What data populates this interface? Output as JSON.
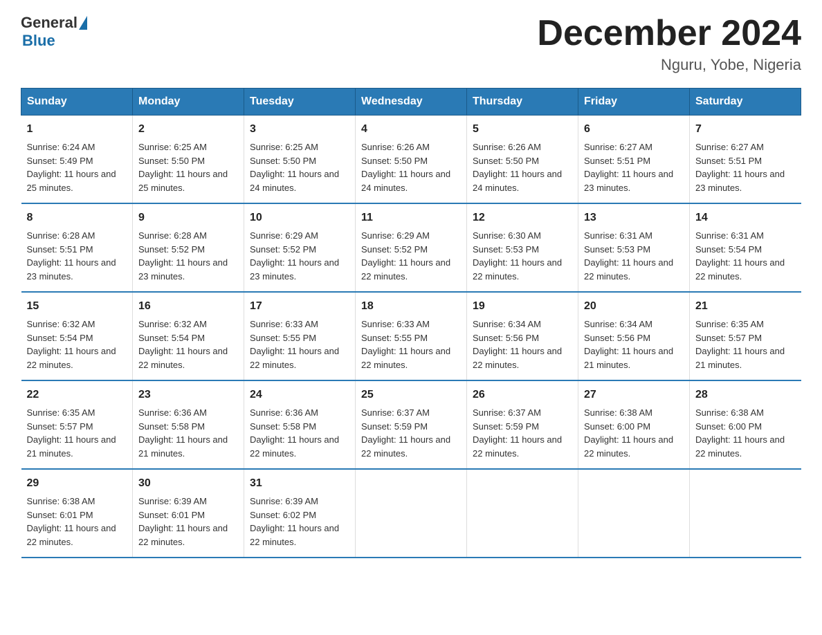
{
  "header": {
    "logo_general": "General",
    "logo_blue": "Blue",
    "month_title": "December 2024",
    "location": "Nguru, Yobe, Nigeria"
  },
  "days_of_week": [
    "Sunday",
    "Monday",
    "Tuesday",
    "Wednesday",
    "Thursday",
    "Friday",
    "Saturday"
  ],
  "weeks": [
    [
      {
        "day": "1",
        "sunrise": "6:24 AM",
        "sunset": "5:49 PM",
        "daylight": "11 hours and 25 minutes."
      },
      {
        "day": "2",
        "sunrise": "6:25 AM",
        "sunset": "5:50 PM",
        "daylight": "11 hours and 25 minutes."
      },
      {
        "day": "3",
        "sunrise": "6:25 AM",
        "sunset": "5:50 PM",
        "daylight": "11 hours and 24 minutes."
      },
      {
        "day": "4",
        "sunrise": "6:26 AM",
        "sunset": "5:50 PM",
        "daylight": "11 hours and 24 minutes."
      },
      {
        "day": "5",
        "sunrise": "6:26 AM",
        "sunset": "5:50 PM",
        "daylight": "11 hours and 24 minutes."
      },
      {
        "day": "6",
        "sunrise": "6:27 AM",
        "sunset": "5:51 PM",
        "daylight": "11 hours and 23 minutes."
      },
      {
        "day": "7",
        "sunrise": "6:27 AM",
        "sunset": "5:51 PM",
        "daylight": "11 hours and 23 minutes."
      }
    ],
    [
      {
        "day": "8",
        "sunrise": "6:28 AM",
        "sunset": "5:51 PM",
        "daylight": "11 hours and 23 minutes."
      },
      {
        "day": "9",
        "sunrise": "6:28 AM",
        "sunset": "5:52 PM",
        "daylight": "11 hours and 23 minutes."
      },
      {
        "day": "10",
        "sunrise": "6:29 AM",
        "sunset": "5:52 PM",
        "daylight": "11 hours and 23 minutes."
      },
      {
        "day": "11",
        "sunrise": "6:29 AM",
        "sunset": "5:52 PM",
        "daylight": "11 hours and 22 minutes."
      },
      {
        "day": "12",
        "sunrise": "6:30 AM",
        "sunset": "5:53 PM",
        "daylight": "11 hours and 22 minutes."
      },
      {
        "day": "13",
        "sunrise": "6:31 AM",
        "sunset": "5:53 PM",
        "daylight": "11 hours and 22 minutes."
      },
      {
        "day": "14",
        "sunrise": "6:31 AM",
        "sunset": "5:54 PM",
        "daylight": "11 hours and 22 minutes."
      }
    ],
    [
      {
        "day": "15",
        "sunrise": "6:32 AM",
        "sunset": "5:54 PM",
        "daylight": "11 hours and 22 minutes."
      },
      {
        "day": "16",
        "sunrise": "6:32 AM",
        "sunset": "5:54 PM",
        "daylight": "11 hours and 22 minutes."
      },
      {
        "day": "17",
        "sunrise": "6:33 AM",
        "sunset": "5:55 PM",
        "daylight": "11 hours and 22 minutes."
      },
      {
        "day": "18",
        "sunrise": "6:33 AM",
        "sunset": "5:55 PM",
        "daylight": "11 hours and 22 minutes."
      },
      {
        "day": "19",
        "sunrise": "6:34 AM",
        "sunset": "5:56 PM",
        "daylight": "11 hours and 22 minutes."
      },
      {
        "day": "20",
        "sunrise": "6:34 AM",
        "sunset": "5:56 PM",
        "daylight": "11 hours and 21 minutes."
      },
      {
        "day": "21",
        "sunrise": "6:35 AM",
        "sunset": "5:57 PM",
        "daylight": "11 hours and 21 minutes."
      }
    ],
    [
      {
        "day": "22",
        "sunrise": "6:35 AM",
        "sunset": "5:57 PM",
        "daylight": "11 hours and 21 minutes."
      },
      {
        "day": "23",
        "sunrise": "6:36 AM",
        "sunset": "5:58 PM",
        "daylight": "11 hours and 21 minutes."
      },
      {
        "day": "24",
        "sunrise": "6:36 AM",
        "sunset": "5:58 PM",
        "daylight": "11 hours and 22 minutes."
      },
      {
        "day": "25",
        "sunrise": "6:37 AM",
        "sunset": "5:59 PM",
        "daylight": "11 hours and 22 minutes."
      },
      {
        "day": "26",
        "sunrise": "6:37 AM",
        "sunset": "5:59 PM",
        "daylight": "11 hours and 22 minutes."
      },
      {
        "day": "27",
        "sunrise": "6:38 AM",
        "sunset": "6:00 PM",
        "daylight": "11 hours and 22 minutes."
      },
      {
        "day": "28",
        "sunrise": "6:38 AM",
        "sunset": "6:00 PM",
        "daylight": "11 hours and 22 minutes."
      }
    ],
    [
      {
        "day": "29",
        "sunrise": "6:38 AM",
        "sunset": "6:01 PM",
        "daylight": "11 hours and 22 minutes."
      },
      {
        "day": "30",
        "sunrise": "6:39 AM",
        "sunset": "6:01 PM",
        "daylight": "11 hours and 22 minutes."
      },
      {
        "day": "31",
        "sunrise": "6:39 AM",
        "sunset": "6:02 PM",
        "daylight": "11 hours and 22 minutes."
      },
      null,
      null,
      null,
      null
    ]
  ]
}
